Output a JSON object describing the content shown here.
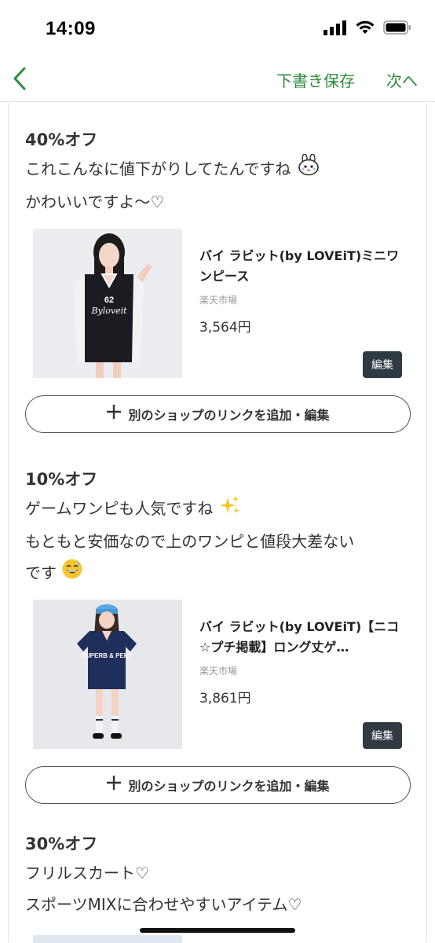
{
  "status_bar": {
    "time": "14:09"
  },
  "nav": {
    "save_draft": "下書き保存",
    "next": "次へ"
  },
  "sections": [
    {
      "discount": "40%オフ",
      "desc_lines": [
        "これこんなに値下がりしてたんですね",
        "かわいいですよ〜♡"
      ],
      "product": {
        "name": "バイ ラビット(by LOVEiT)ミニワンピース",
        "shop": "楽天市場",
        "price": "3,564円",
        "edit_label": "編集"
      },
      "add_link_label": "別のショップのリンクを追加・編集"
    },
    {
      "discount": "10%オフ",
      "desc_lines": [
        "ゲームワンピも人気ですね",
        "もともと安価なので上のワンピと値段大差ない",
        "です"
      ],
      "product": {
        "name": "バイ ラビット(by LOVEiT)【ニコ☆プチ掲載】ロング丈ゲ…",
        "shop": "楽天市場",
        "price": "3,861円",
        "edit_label": "編集"
      },
      "add_link_label": "別のショップのリンクを追加・編集"
    },
    {
      "discount": "30%オフ",
      "desc_lines": [
        "フリルスカート♡",
        "スポーツMIXに合わせやすいアイテム♡"
      ]
    }
  ],
  "image_texts": {
    "shirt1_number": "62",
    "shirt1_script": "Byloveit",
    "shirt2_text": "SUPERB & PERF"
  }
}
